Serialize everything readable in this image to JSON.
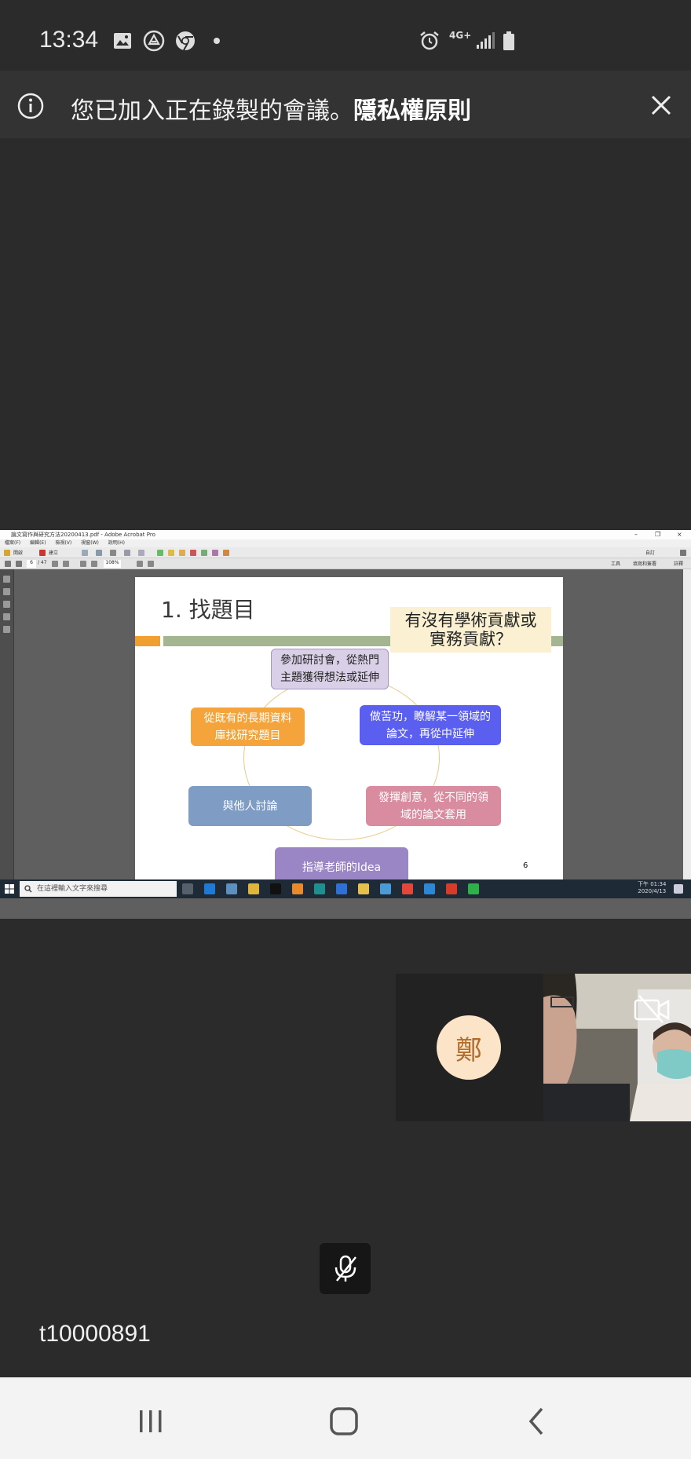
{
  "status_bar": {
    "time": "13:34",
    "network": "4G+"
  },
  "banner": {
    "message": "您已加入正在錄製的會議。",
    "link": "隱私權原則"
  },
  "shared_screen": {
    "window_title": "論文寫作與研究方法20200413.pdf - Adobe Acrobat Pro",
    "menu": [
      "檔案(F)",
      "編輯(E)",
      "檢視(V)",
      "視窗(W)",
      "說明(H)"
    ],
    "toolbar": {
      "open": "開啟",
      "create": "建立",
      "page_current": "6",
      "page_total": "/ 47",
      "zoom": "108%",
      "tools": "工具",
      "sign": "填寫和簽署",
      "comment": "註釋",
      "customize": "自訂"
    },
    "slide": {
      "title": "1. 找題目",
      "callout": "有沒有學術貢獻或\n實務貢獻？",
      "nodes": {
        "top": "參加研討會，從熱門主題獲得想法或延伸",
        "upper_left": "從既有的長期資料庫找研究題目",
        "upper_right": "做苦功，瞭解某一領域的論文，再從中延伸",
        "lower_left": "與他人討論",
        "lower_right": "發揮創意，從不同的領域的論文套用",
        "bottom": "指導老師的Idea"
      },
      "page_number": "6"
    },
    "taskbar": {
      "search_placeholder": "在這裡輸入文字來搜尋",
      "clock_time": "下午 01:34",
      "clock_date": "2020/4/13"
    }
  },
  "participant": {
    "avatar_initial": "鄭"
  },
  "meeting_id": "t10000891",
  "colors": {
    "background": "#2b2b2b",
    "banner": "#333333",
    "node_top": "#d9d0e8",
    "node_upper_left": "#f4a43a",
    "node_upper_right": "#5b5ff0",
    "node_lower_left": "#7f9cc4",
    "node_lower_right": "#d98ca0",
    "node_bottom": "#9a86c4"
  }
}
